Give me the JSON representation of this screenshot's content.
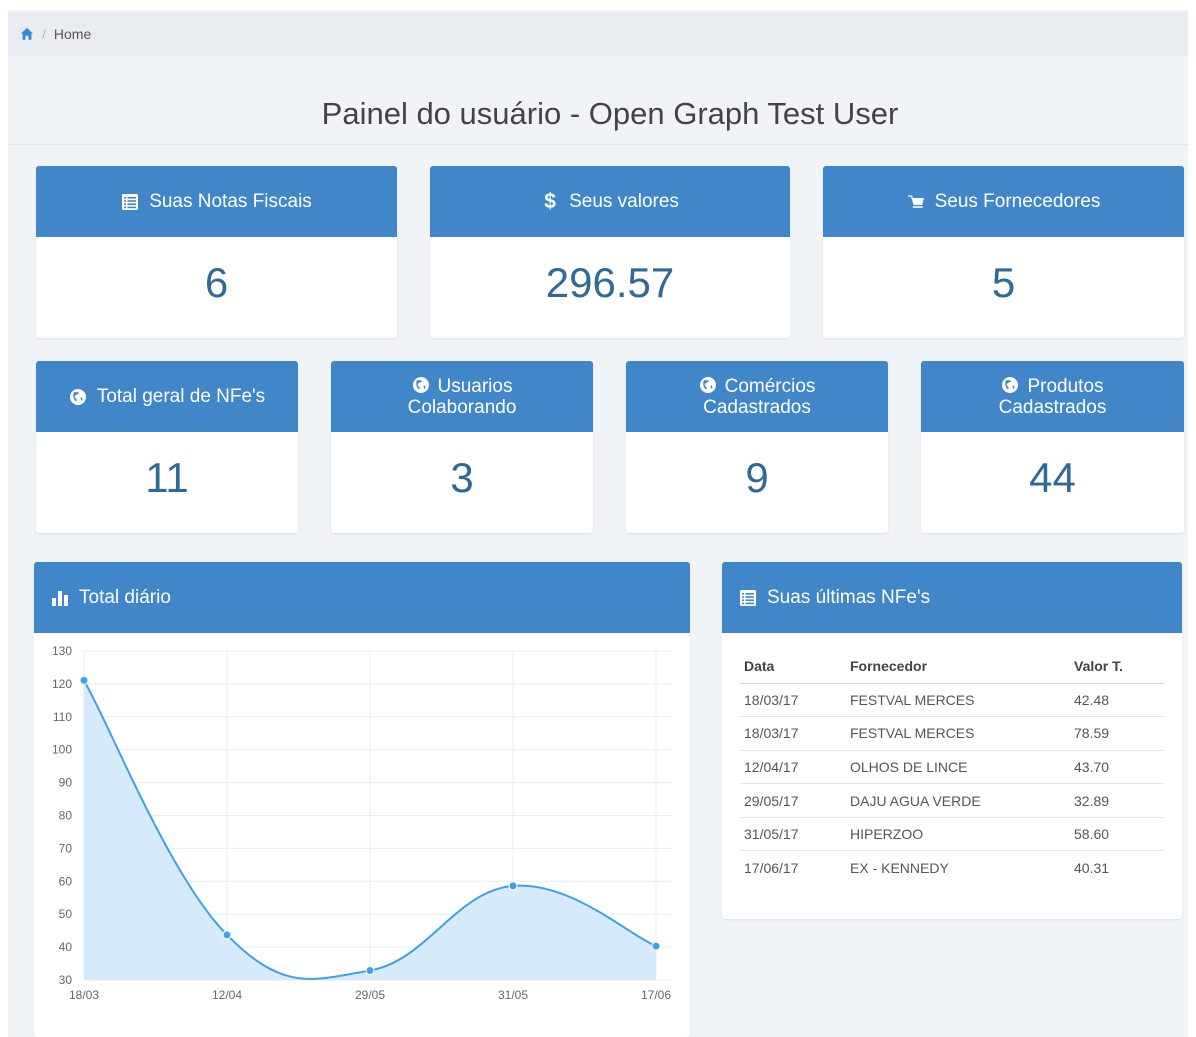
{
  "breadcrumb": {
    "home_icon": "home-icon",
    "label": "Home"
  },
  "page_title": "Painel do usuário - Open Graph Test User",
  "colors": {
    "accent": "#4086c9",
    "value_text": "#2f6a94",
    "line": "#3ea1e6",
    "area": "#d6eafb"
  },
  "stats_top": [
    {
      "icon": "list-icon",
      "label": "Suas Notas Fiscais",
      "value": "6"
    },
    {
      "icon": "dollar-icon",
      "label": "Seus valores",
      "value": "296.57"
    },
    {
      "icon": "cart-icon",
      "label": "Seus Fornecedores",
      "value": "5"
    }
  ],
  "stats_bottom": [
    {
      "icon": "globe-icon",
      "label": "Total geral de NFe's",
      "value": "11"
    },
    {
      "icon": "globe-icon",
      "label_line1": "Usuarios",
      "label_line2": "Colaborando",
      "value": "3"
    },
    {
      "icon": "globe-icon",
      "label_line1": "Comércios",
      "label_line2": "Cadastrados",
      "value": "9"
    },
    {
      "icon": "globe-icon",
      "label_line1": "Produtos",
      "label_line2": "Cadastrados",
      "value": "44"
    }
  ],
  "chart_panel": {
    "icon": "bar-chart-icon",
    "title": "Total diário"
  },
  "chart_data": {
    "type": "area",
    "x": [
      "18/03",
      "12/04",
      "29/05",
      "31/05",
      "17/06"
    ],
    "values": [
      121.07,
      43.7,
      32.89,
      58.6,
      40.31
    ],
    "ylim": [
      30,
      130
    ],
    "yticks": [
      30,
      40,
      50,
      60,
      70,
      80,
      90,
      100,
      110,
      120,
      130
    ],
    "grid": true
  },
  "table_panel": {
    "icon": "list-icon",
    "title": "Suas últimas NFe's",
    "columns": [
      "Data",
      "Fornecedor",
      "Valor T."
    ],
    "rows": [
      [
        "18/03/17",
        "FESTVAL MERCES",
        "42.48"
      ],
      [
        "18/03/17",
        "FESTVAL MERCES",
        "78.59"
      ],
      [
        "12/04/17",
        "OLHOS DE LINCE",
        "43.70"
      ],
      [
        "29/05/17",
        "DAJU AGUA VERDE",
        "32.89"
      ],
      [
        "31/05/17",
        "HIPERZOO",
        "58.60"
      ],
      [
        "17/06/17",
        "EX - KENNEDY",
        "40.31"
      ]
    ]
  }
}
